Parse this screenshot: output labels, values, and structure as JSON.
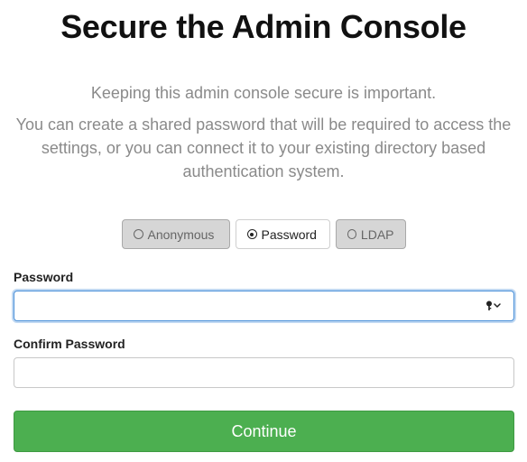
{
  "header": {
    "title": "Secure the Admin Console"
  },
  "intro": {
    "line1": "Keeping this admin console secure is important.",
    "line2": "You can create a shared password that will be required to access the settings, or you can connect it to your existing directory based authentication system."
  },
  "auth_modes": {
    "options": [
      {
        "label": "Anonymous",
        "selected": false
      },
      {
        "label": "Password",
        "selected": true
      },
      {
        "label": "LDAP",
        "selected": false
      }
    ]
  },
  "form": {
    "password_label": "Password",
    "password_value": "",
    "confirm_label": "Confirm Password",
    "confirm_value": "",
    "continue_label": "Continue"
  },
  "icons": {
    "password_autofill": "key-icon"
  },
  "colors": {
    "accent_green": "#4caf50",
    "focus_blue": "#4a90d9"
  }
}
